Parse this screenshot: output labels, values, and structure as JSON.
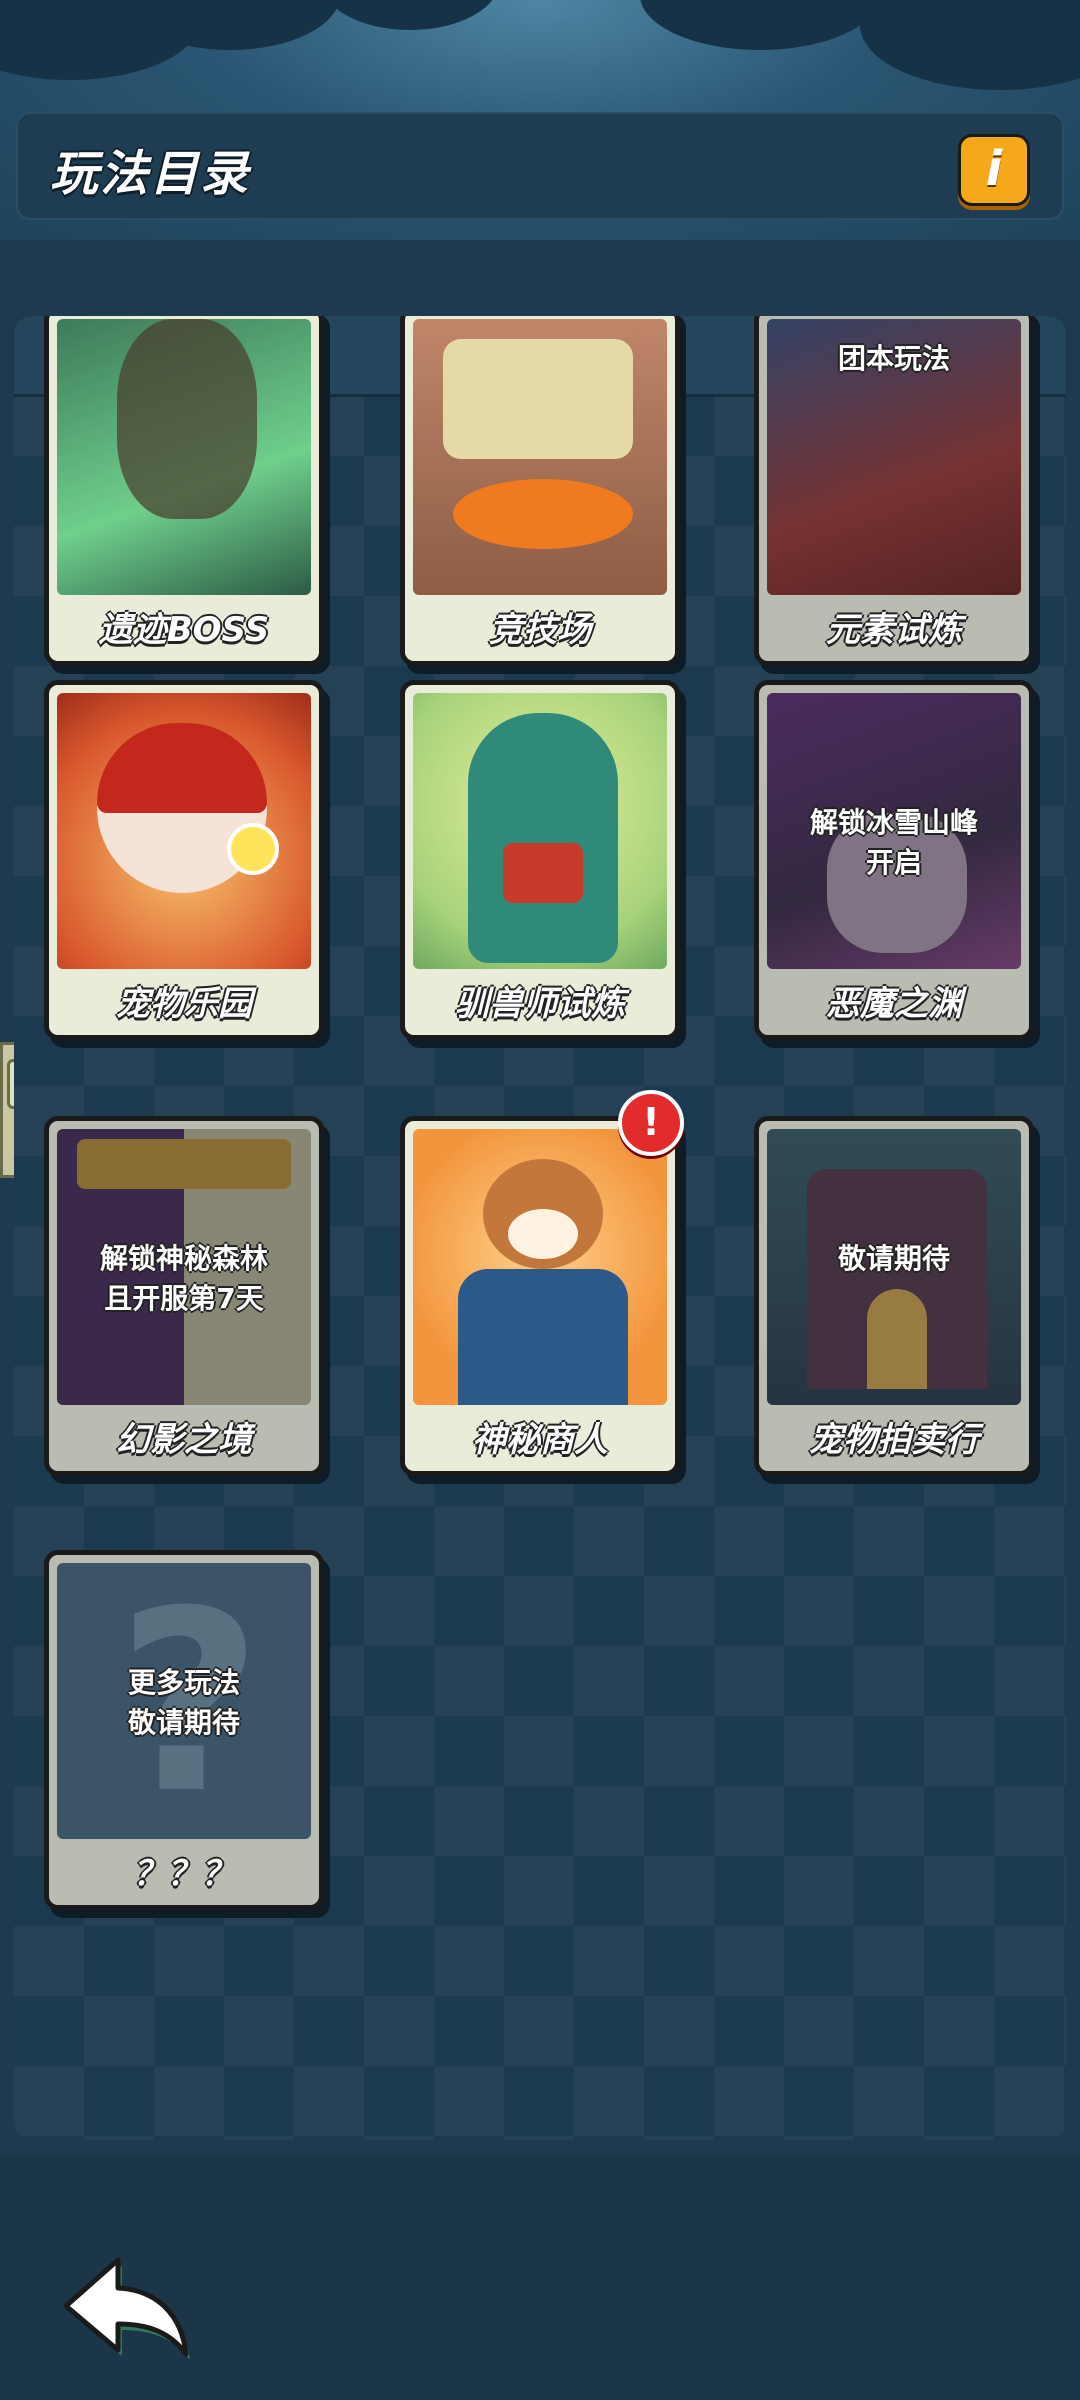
{
  "header": {
    "title": "玩法目录",
    "info_icon": "info-icon",
    "info_label": "i"
  },
  "colors": {
    "background": "#1d3a4f",
    "accent": "#f4a81a",
    "badge": "#e42b2b"
  },
  "cards": [
    {
      "label": "遗迹BOSS",
      "state": "partial"
    },
    {
      "label": "竞技场",
      "state": "partial"
    },
    {
      "label": "元素试炼",
      "state": "partial",
      "lock_text": "团本玩法"
    },
    {
      "label": "宠物乐园"
    },
    {
      "label": "驯兽师试炼"
    },
    {
      "label": "恶魔之渊",
      "lock_text": "解锁冰雪山峰\n开启"
    },
    {
      "label": "幻影之境",
      "lock_text": "解锁神秘森林\n且开服第7天"
    },
    {
      "label": "神秘商人",
      "badge": "!"
    },
    {
      "label": "宠物拍卖行",
      "lock_text": "敬请期待"
    },
    {
      "label": "？？？",
      "lock_text": "更多玩法\n敬请期待"
    }
  ],
  "footer": {
    "back_icon": "back-arrow-icon"
  }
}
